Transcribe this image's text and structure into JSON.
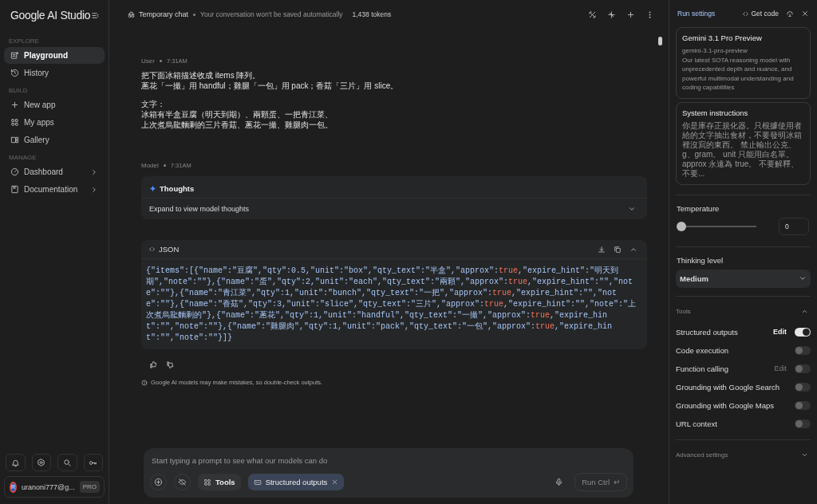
{
  "sidebar": {
    "title": "Google AI Studio",
    "sections": [
      {
        "label": "EXPLORE",
        "items": [
          {
            "label": "Playground",
            "selected": true,
            "arrow": false
          },
          {
            "label": "History",
            "selected": false,
            "arrow": false
          }
        ]
      },
      {
        "label": "BUILD",
        "items": [
          {
            "label": "New app",
            "selected": false,
            "arrow": false
          },
          {
            "label": "My apps",
            "selected": false,
            "arrow": false
          },
          {
            "label": "Gallery",
            "selected": false,
            "arrow": false
          }
        ]
      },
      {
        "label": "MANAGE",
        "items": [
          {
            "label": "Dashboard",
            "selected": false,
            "arrow": true
          },
          {
            "label": "Documentation",
            "selected": false,
            "arrow": true
          }
        ]
      }
    ],
    "account": {
      "avatar": "R",
      "email": "uranoni777@g...",
      "badge": "PRO"
    }
  },
  "topbar": {
    "title": "Temporary chat",
    "note": "Your conversation won't be saved automatically",
    "tokens": "1,438 tokens"
  },
  "messages": [
    {
      "kind": "user",
      "role": "User",
      "time": "7:31AM",
      "paragraphs": [
        [
          "把下面冰箱描述收成 items 陣列。",
          "蔥花「一撮」用 handful；雞腿「一包」用 pack；香菇「三片」用 slice。"
        ],
        [
          "文字：",
          "冰箱有半盒豆腐（明天到期）、兩顆蛋、一把青江菜、",
          "上次煮烏龍麵剩的三片香菇、蔥花一撮、雞腿肉一包。"
        ]
      ]
    },
    {
      "kind": "model",
      "role": "Model",
      "time": "7:31AM",
      "thoughts": {
        "title": "Thoughts",
        "hint": "Expand to view model thoughts",
        "expanded": false
      },
      "code": {
        "title": "JSON",
        "tokens": [
          {
            "kind": "text",
            "text": "{\"items\":[{\"name\":\"豆腐\",\"qty\":0.5,\"unit\":\"box\",\"qty_text\":\"半盒\",\"approx\":"
          },
          {
            "kind": "bool",
            "text": "true"
          },
          {
            "kind": "text",
            "text": ",\"expire_hint\":\"明天到期\",\"note\":\"\"},{\"name\":\"蛋\",\"qty\":2,\"unit\":\"each\",\"qty_text\":\"兩顆\",\"approx\":"
          },
          {
            "kind": "bool",
            "text": "true"
          },
          {
            "kind": "text",
            "text": ",\"expire_hint\":\"\",\"note\":\"\"},{\"name\":\"青江菜\",\"qty\":1,\"unit\":\"bunch\",\"qty_text\":\"一把\",\"approx\":"
          },
          {
            "kind": "bool",
            "text": "true"
          },
          {
            "kind": "text",
            "text": ",\"expire_hint\":\"\",\"note\":\"\"},{\"name\":\"香菇\",\"qty\":3,\"unit\":\"slice\",\"qty_text\":\"三片\",\"approx\":"
          },
          {
            "kind": "bool",
            "text": "true"
          },
          {
            "kind": "text",
            "text": ",\"expire_hint\":\"\",\"note\":\"上次煮烏龍麵剩的\"},{\"name\":\"蔥花\",\"qty\":1,\"unit\":\"handful\",\"qty_text\":\"一撮\",\"approx\":"
          },
          {
            "kind": "bool",
            "text": "true"
          },
          {
            "kind": "text",
            "text": ",\"expire_hint\":\"\",\"note\":\"\"},{\"name\":\"雞腿肉\",\"qty\":1,\"unit\":\"pack\",\"qty_text\":\"一包\",\"approx\":"
          },
          {
            "kind": "bool",
            "text": "true"
          },
          {
            "kind": "text",
            "text": ",\"expire_hint\":\"\",\"note\":\"\"}]}"
          }
        ]
      }
    }
  ],
  "disclaimer": "Google AI models may make mistakes, so double-check outputs.",
  "prompt": {
    "placeholder": "Start typing a prompt to see what our models can do",
    "tools": "Tools",
    "chip": "Structured outputs",
    "run": "Run Ctrl",
    "run_key": "↵",
    "run_disabled": true
  },
  "settings": {
    "title": "Run settings",
    "get_code": "Get code",
    "model": {
      "name": "Gemini 3.1 Pro Preview",
      "id": "gemini-3.1-pro-preview",
      "description": "Our latest SOTA reasoning model with unprecedented depth and nuance, and powerful multimodal understanding and coding capabilities"
    },
    "system": {
      "title": "System instructions",
      "text": "你是庫存正規化器。只根據使用者給的文字抽出食材，不要發明冰箱裡沒寫的東西。 禁止輸出公克、g、gram。 unit 只能用白名單。 approx 永遠為 true。 不要解釋、不要..."
    },
    "temperature": {
      "label": "Temperature",
      "level": 0,
      "value": "0"
    },
    "thinking": {
      "label": "Thinking level",
      "value": "Medium"
    },
    "tools": {
      "label": "Tools",
      "expanded": true,
      "items": [
        {
          "label": "Structured outputs",
          "on": true,
          "edit": "Edit",
          "edit_disabled": false
        },
        {
          "label": "Code execution",
          "on": false
        },
        {
          "label": "Function calling",
          "on": false,
          "edit": "Edit",
          "edit_disabled": true
        },
        {
          "label": "Grounding with Google Search",
          "on": false
        },
        {
          "label": "Grounding with Google Maps",
          "on": false
        },
        {
          "label": "URL context",
          "on": false
        }
      ]
    },
    "advanced": {
      "label": "Advanced settings",
      "expanded": false
    }
  }
}
